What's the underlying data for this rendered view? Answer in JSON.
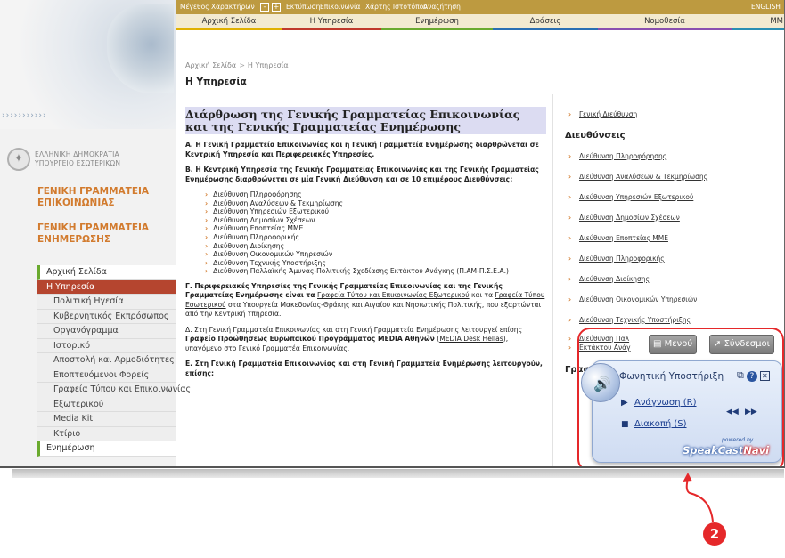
{
  "topbar": {
    "font_size_label": "Μέγεθος Χαρακτήρων",
    "font_minus": "-",
    "font_plus": "+",
    "print": "Εκτύπωση",
    "contact": "Επικοινωνία",
    "sitemap": "Χάρτης Ιστοτόπου",
    "search": "Αναζήτηση",
    "english": "ENGLISH"
  },
  "nav": {
    "home": "Αρχική Σελίδα",
    "service": "Η Υπηρεσία",
    "info": "Ενημέρωση",
    "actions": "Δράσεις",
    "law": "Νομοθεσία",
    "mm": "ΜΜ"
  },
  "brand": {
    "arrows": "›››››››››››",
    "gov_line1": "ΕΛΛΗΝΙΚΗ ΔΗΜΟΚΡΑΤΙΑ",
    "gov_line2": "ΥΠΟΥΡΓΕΙΟ ΕΣΩΤΕΡΙΚΩΝ",
    "sec1_line1": "ΓΕΝΙΚΗ ΓΡΑΜΜΑΤΕΙΑ",
    "sec1_line2": "ΕΠΙΚΟΙΝΩΝΙΑΣ",
    "sec2_line1": "ΓΕΝΙΚΗ ΓΡΑΜΜΑΤΕΙΑ",
    "sec2_line2": "ΕΝΗΜΕΡΩΣΗΣ"
  },
  "sidebar": {
    "items": [
      {
        "label": "Αρχική Σελίδα"
      },
      {
        "label": "Η Υπηρεσία"
      },
      {
        "label": "Πολιτική Ηγεσία"
      },
      {
        "label": "Κυβερνητικός Εκπρόσωπος"
      },
      {
        "label": "Οργανόγραμμα"
      },
      {
        "label": "Ιστορικό"
      },
      {
        "label": "Αποστολή και Αρμοδιότητες"
      },
      {
        "label": "Εποπτευόμενοι Φορείς"
      },
      {
        "label": "Γραφεία Τύπου και Επικοινωνίας"
      },
      {
        "label": "Εξωτερικού"
      },
      {
        "label": "Media Kit"
      },
      {
        "label": "Κτίριο"
      },
      {
        "label": "Ενημέρωση"
      }
    ]
  },
  "breadcrumb": {
    "home": "Αρχική Σελίδα",
    "separator": ">",
    "current": "Η Υπηρεσία"
  },
  "page_title": "Η Υπηρεσία",
  "main": {
    "heading": "Διάρθρωση  της Γενικής Γραμματείας Επικοινωνίας και της Γενικής Γραμματείας Ενημέρωσης",
    "p_a": "Α. Η Γενική Γραμματεία Επικοινωνίας και η Γενική Γραμματεία Ενημέρωσης διαρθρώνεται σε Κεντρική Υπηρεσία και Περιφερειακές Υπηρεσίες.",
    "p_b": "Β. Η Κεντρική Υπηρεσία της Γενικής Γραμματείας Επικοινωνίας και της Γενικής Γραμματείας Ενημέρωσης διαρθρώνεται σε μία Γενική Διεύθυνση και σε 10 επιμέρους Διευθύνσεις:",
    "list": [
      "Διεύθυνση Πληροφόρησης",
      "Διεύθυνση Αναλύσεων & Τεκμηρίωσης",
      "Διεύθυνση Υπηρεσιών Εξωτερικού",
      "Διεύθυνση Δημοσίων Σχέσεων",
      "Διεύθυνση Εποπτείας ΜΜΕ",
      "Διεύθυνση Πληροφορικής",
      "Διεύθυνση Διοίκησης",
      "Διεύθυνση Οικονομικών Υπηρεσιών",
      "Διεύθυνση Τεχνικής Υποστήριξης",
      "Διεύθυνση Παλλαϊκής Άμυνας-Πολιτικής Σχεδίασης Εκτάκτου Ανάγκης (Π.ΑΜ-Π.Σ.Ε.Α.)"
    ],
    "p_g_bold": "Γ. Περιφερειακές Υπηρεσίες της Γενικής Γραμματείας Επικοινωνίας και της Γενικής Γραμματείας Ενημέρωσης είναι τα",
    "p_g_link1": "Γραφεία Τύπου και Επικοινωνίας Εξωτερικού",
    "p_g_mid": "και τα",
    "p_g_link2": "Γραφεία Τύπου Εσωτερικού",
    "p_g_rest": "στα Υπουργεία Μακεδονίας-Θράκης και Αιγαίου και Νησιωτικής Πολιτικής, που εξαρτώνται από την Κεντρική Υπηρεσία.",
    "p_d_start": "Δ. Στη Γενική Γραμματεία Επικοινωνίας και στη Γενική Γραμματεία Ενημέρωσης λειτουργεί επίσης",
    "p_d_bold": "Γραφείο Προώθησεως Ευρωπαϊκού Προγράμματος MEDIA Αθηνών",
    "p_d_link": "MEDIA Desk Hellas",
    "p_d_end": "υπαγόμενο στο Γενικό Γραμματέα Επικοινωνίας.",
    "p_e": "Ε. Στη Γενική Γραμματεία Επικοινωνίας και στη Γενική Γραμματεία Ενημέρωσης λειτουργούν, επίσης:"
  },
  "right": {
    "general": "Γενική Διεύθυνση",
    "directorates_heading": "Διευθύνσεις",
    "links": [
      "Διεύθυνση Πληροφόρησης",
      "Διεύθυνση Αναλύσεων & Τεκμηρίωσης",
      "Διεύθυνση Υπηρεσιών Εξωτερικού",
      "Διεύθυνση Δημοσίων Σχέσεων",
      "Διεύθυνση Εποπτείας ΜΜΕ",
      "Διεύθυνση Πληροφορικής",
      "Διεύθυνση Διοίκησης",
      "Διεύθυνση Οικονομικών Υπηρεσιών",
      "Διεύθυνση Τεχνικής Υποστήριξης",
      "Διεύθυνση Παλ",
      "Εκτάκτου Ανάγ"
    ],
    "offices_heading": "Γραφεί"
  },
  "widget": {
    "menu_label": "Μενού",
    "links_label": "Σύνδεσμοι",
    "title": "Φωνητική Υποστήριξη",
    "read_label": "Ανάγνωση (R)",
    "stop_label": "Διακοπή (S)",
    "rewind": "◀◀",
    "forward": "▶▶",
    "help_icon": "?",
    "close_icon": "✕",
    "logo_main": "SpeakCast",
    "logo_navi": "Navi",
    "logo_small": "powered by"
  },
  "annotation": {
    "number": "2"
  },
  "colors": {
    "accent_orange": "#d27b2e",
    "active_red": "#b5452f",
    "topbar": "#bd9a40",
    "annotation_red": "#e5282a"
  }
}
